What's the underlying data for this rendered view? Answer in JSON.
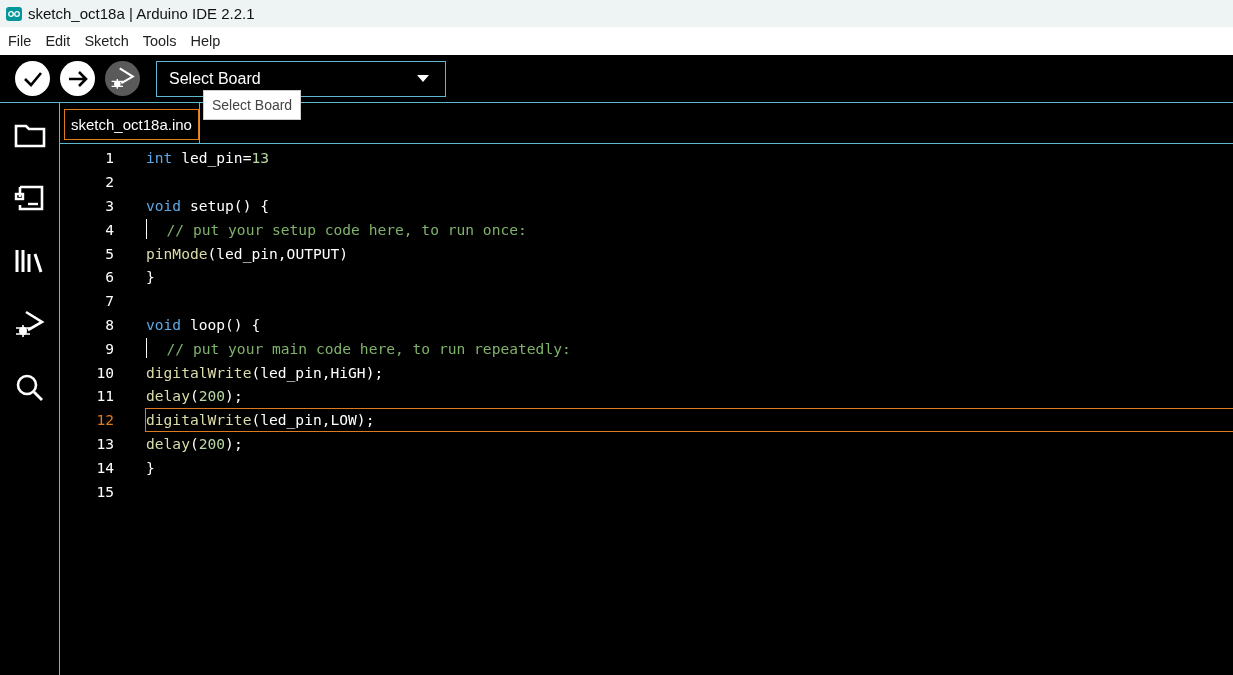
{
  "window": {
    "title": "sketch_oct18a | Arduino IDE 2.2.1"
  },
  "menu": [
    "File",
    "Edit",
    "Sketch",
    "Tools",
    "Help"
  ],
  "toolbar": {
    "board_select": {
      "value": "Select Board"
    },
    "tooltip": "Select Board",
    "debug_disabled": true
  },
  "sidebar": {
    "items": [
      {
        "kind": "folder"
      },
      {
        "kind": "board"
      },
      {
        "kind": "library"
      },
      {
        "kind": "debug"
      },
      {
        "kind": "search"
      }
    ]
  },
  "tabs": [
    {
      "label": "sketch_oct18a.ino",
      "selected": true
    }
  ],
  "editor": {
    "lines": [
      {
        "number": "1",
        "current": false,
        "tokens": [
          {
            "text": "int",
            "kind": "keyword"
          },
          {
            "text": " led_pin=",
            "kind": "plain"
          },
          {
            "text": "13",
            "kind": "number"
          }
        ]
      },
      {
        "number": "2",
        "current": false
      },
      {
        "number": "3",
        "current": false,
        "tokens": [
          {
            "text": "void",
            "kind": "keyword"
          },
          {
            "text": " setup() {",
            "kind": "plain"
          }
        ]
      },
      {
        "number": "4",
        "current": false,
        "guide": true,
        "tokens": [
          {
            "text": "  // put your setup code here, to run once:",
            "kind": "comment"
          }
        ]
      },
      {
        "number": "5",
        "current": false,
        "tokens": [
          {
            "text": "pinMode",
            "kind": "function"
          },
          {
            "text": "(led_pin,OUTPUT)",
            "kind": "plain"
          }
        ]
      },
      {
        "number": "6",
        "current": false,
        "tokens": [
          {
            "text": "}",
            "kind": "plain"
          }
        ]
      },
      {
        "number": "7",
        "current": false
      },
      {
        "number": "8",
        "current": false,
        "tokens": [
          {
            "text": "void",
            "kind": "keyword"
          },
          {
            "text": " loop() {",
            "kind": "plain"
          }
        ]
      },
      {
        "number": "9",
        "current": false,
        "guide": true,
        "tokens": [
          {
            "text": "  // put your main code here, to run repeatedly:",
            "kind": "comment"
          }
        ]
      },
      {
        "number": "10",
        "current": false,
        "tokens": [
          {
            "text": "digitalWrite",
            "kind": "function"
          },
          {
            "text": "(led_pin,HiGH);",
            "kind": "plain"
          }
        ]
      },
      {
        "number": "11",
        "current": false,
        "tokens": [
          {
            "text": "delay",
            "kind": "function"
          },
          {
            "text": "(",
            "kind": "plain"
          },
          {
            "text": "200",
            "kind": "number"
          },
          {
            "text": ");",
            "kind": "plain"
          }
        ]
      },
      {
        "number": "12",
        "current": true,
        "tokens": [
          {
            "text": "digitalWrite",
            "kind": "function"
          },
          {
            "text": "(led_pin,LOW);",
            "kind": "plain"
          }
        ]
      },
      {
        "number": "13",
        "current": false,
        "tokens": [
          {
            "text": "delay",
            "kind": "function"
          },
          {
            "text": "(",
            "kind": "plain"
          },
          {
            "text": "200",
            "kind": "number"
          },
          {
            "text": ");",
            "kind": "plain"
          }
        ]
      },
      {
        "number": "14",
        "current": false,
        "tokens": [
          {
            "text": "}",
            "kind": "plain"
          }
        ]
      },
      {
        "number": "15",
        "current": false
      }
    ]
  }
}
